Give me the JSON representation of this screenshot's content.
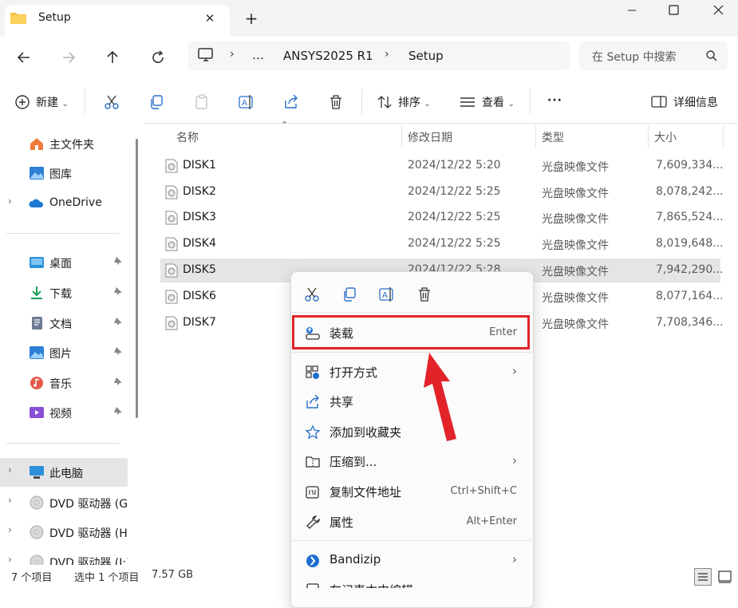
{
  "window": {
    "tab_title": "Setup",
    "new_tab_symbol": "+",
    "close_tab_symbol": "✕",
    "controls": [
      "minimize",
      "maximize",
      "close"
    ]
  },
  "address": {
    "path": [
      "…",
      "ANSYS2025 R1",
      "Setup"
    ],
    "search_placeholder": "在 Setup 中搜索"
  },
  "toolbar": {
    "new_label": "新建",
    "sort_label": "排序",
    "view_label": "查看",
    "more_label": "···",
    "details_label": "详细信息"
  },
  "sidebar": {
    "items": [
      {
        "label": "主文件夹",
        "icon": "home-icon"
      },
      {
        "label": "图库",
        "icon": "gallery-icon"
      },
      {
        "label": "OneDrive",
        "icon": "cloud-icon"
      },
      {
        "label": "桌面",
        "icon": "desktop-icon"
      },
      {
        "label": "下载",
        "icon": "download-icon"
      },
      {
        "label": "文档",
        "icon": "document-icon"
      },
      {
        "label": "图片",
        "icon": "pictures-icon"
      },
      {
        "label": "音乐",
        "icon": "music-icon"
      },
      {
        "label": "视频",
        "icon": "video-icon"
      },
      {
        "label": "此电脑",
        "icon": "computer-icon"
      },
      {
        "label": "DVD 驱动器 (G",
        "icon": "dvd-icon"
      },
      {
        "label": "DVD 驱动器 (H",
        "icon": "dvd-icon"
      },
      {
        "label": "DVD 驱动器 (I:)",
        "icon": "dvd-icon"
      }
    ]
  },
  "filelist": {
    "columns": [
      "名称",
      "修改日期",
      "类型",
      "大小"
    ],
    "rows": [
      {
        "name": "DISK1",
        "date": "2024/12/22 5:20",
        "type": "光盘映像文件",
        "size": "7,609,334..."
      },
      {
        "name": "DISK2",
        "date": "2024/12/22 5:25",
        "type": "光盘映像文件",
        "size": "8,078,242..."
      },
      {
        "name": "DISK3",
        "date": "2024/12/22 5:25",
        "type": "光盘映像文件",
        "size": "7,865,524..."
      },
      {
        "name": "DISK4",
        "date": "2024/12/22 5:25",
        "type": "光盘映像文件",
        "size": "8,019,648..."
      },
      {
        "name": "DISK5",
        "date": "2024/12/22 5:28",
        "type": "光盘映像文件",
        "size": "7,942,290..."
      },
      {
        "name": "DISK6",
        "date": "",
        "type": "光盘映像文件",
        "size": "8,077,164..."
      },
      {
        "name": "DISK7",
        "date": "",
        "type": "光盘映像文件",
        "size": "7,708,346..."
      }
    ]
  },
  "context_menu": {
    "items": [
      {
        "label": "装载",
        "shortcut": "Enter"
      },
      {
        "label": "打开方式",
        "shortcut": ""
      },
      {
        "label": "共享",
        "shortcut": ""
      },
      {
        "label": "添加到收藏夹",
        "shortcut": ""
      },
      {
        "label": "压缩到...",
        "shortcut": ""
      },
      {
        "label": "复制文件地址",
        "shortcut": "Ctrl+Shift+C"
      },
      {
        "label": "属性",
        "shortcut": "Alt+Enter"
      },
      {
        "label": "Bandizip",
        "shortcut": ""
      },
      {
        "label": "在记事本中编辑",
        "shortcut": ""
      }
    ]
  },
  "status": {
    "item_count": "7 个项目",
    "selection": "选中 1 个项目",
    "selection_size": "7.57 GB"
  },
  "colors": {
    "highlight_border": "#e3232a",
    "selected_row": "#e5e5e5",
    "accent": "#0067c0"
  }
}
